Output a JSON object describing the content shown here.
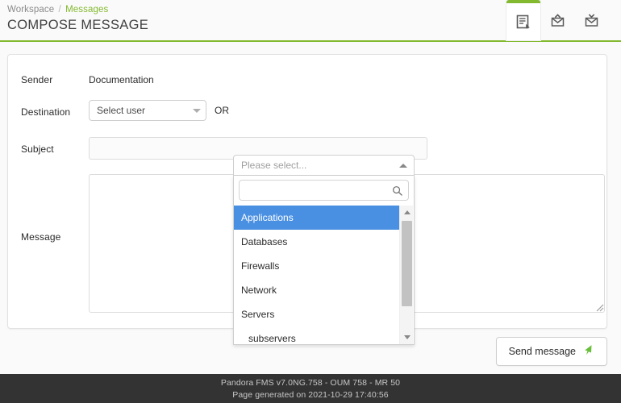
{
  "header": {
    "breadcrumb": {
      "root": "Workspace",
      "separator": "/",
      "current": "Messages"
    },
    "title": "COMPOSE MESSAGE",
    "tabs": [
      {
        "name": "compose-message",
        "icon": "compose-document-icon",
        "active": true
      },
      {
        "name": "sent-messages",
        "icon": "envelope-up-icon",
        "active": false
      },
      {
        "name": "received-messages",
        "icon": "envelope-down-icon",
        "active": false
      }
    ],
    "accent_color": "#82b92e"
  },
  "form": {
    "sender": {
      "label": "Sender",
      "value": "Documentation"
    },
    "destination": {
      "label": "Destination",
      "user_select_value": "Select user",
      "or_text": "OR"
    },
    "subject": {
      "label": "Subject",
      "value": "",
      "placeholder": ""
    },
    "message": {
      "label": "Message",
      "value": "",
      "placeholder": ""
    }
  },
  "group_select": {
    "placeholder": "Please select...",
    "search_value": "",
    "search_placeholder": "",
    "search_icon": "magnifier-icon",
    "options": [
      {
        "label": "Applications",
        "selected": true,
        "child": false
      },
      {
        "label": "Databases",
        "selected": false,
        "child": false
      },
      {
        "label": "Firewalls",
        "selected": false,
        "child": false
      },
      {
        "label": "Network",
        "selected": false,
        "child": false
      },
      {
        "label": "Servers",
        "selected": false,
        "child": false
      },
      {
        "label": "subservers",
        "selected": false,
        "child": true
      }
    ],
    "highlight_color": "#4a90e2"
  },
  "actions": {
    "send_label": "Send message",
    "send_icon": "green-arrow-icon"
  },
  "footer": {
    "version_line": "Pandora FMS v7.0NG.758 - OUM 758 - MR 50",
    "generated_line": "Page generated on 2021-10-29 17:40:56"
  }
}
